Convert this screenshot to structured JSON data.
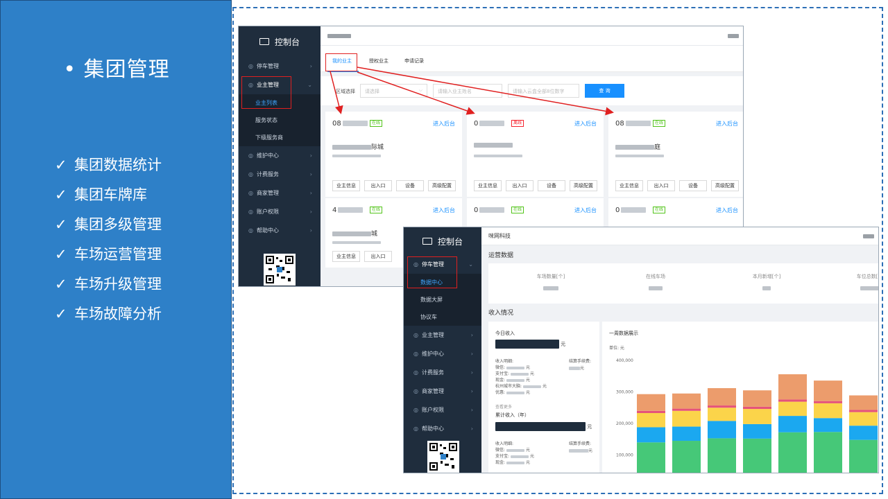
{
  "slide": {
    "title": "• 集团管理",
    "features": [
      "集团数据统计",
      "集团车牌库",
      "集团多级管理",
      "车场运营管理",
      "车场升级管理",
      "车场故障分析"
    ],
    "check_glyph": "✓"
  },
  "screen1": {
    "sidebar": {
      "brand": "控制台",
      "items": [
        {
          "icon": "circle-p-icon",
          "label": "停车管理"
        },
        {
          "icon": "building-icon",
          "label": "业主管理"
        },
        {
          "icon": "wrench-icon",
          "label": "维护中心"
        },
        {
          "icon": "billing-icon",
          "label": "计费服务"
        },
        {
          "icon": "shop-icon",
          "label": "商家管理"
        },
        {
          "icon": "account-icon",
          "label": "账户权限"
        },
        {
          "icon": "help-icon",
          "label": "帮助中心"
        }
      ],
      "subitems": [
        "业主列表",
        "服务状态",
        "下级服务商"
      ]
    },
    "tabs": [
      "我的业主",
      "授权业主",
      "申请记录"
    ],
    "filter": {
      "label": "区域选择",
      "select_placeholder": "请选择",
      "input1_placeholder": "请输入业主姓名",
      "input2_placeholder": "请输入云盒全部8位数字",
      "query": "查 询"
    },
    "cards": [
      {
        "num": "08",
        "badge": "在线",
        "status": "online",
        "enter": "进入后台",
        "name": "",
        "name_tail": "际城"
      },
      {
        "num": "0",
        "badge": "离线",
        "status": "offline",
        "enter": "进入后台",
        "name": "",
        "name_tail": ""
      },
      {
        "num": "08",
        "badge": "在线",
        "status": "online",
        "enter": "进入后台",
        "name": "",
        "name_tail": "庭"
      },
      {
        "num": "4",
        "badge": "在线",
        "status": "online",
        "enter": "进入后台",
        "name": "",
        "name_tail": "城"
      },
      {
        "num": "0",
        "badge": "在线",
        "status": "online",
        "enter": "进入后台",
        "name": "",
        "name_tail": ""
      },
      {
        "num": "0",
        "badge": "在线",
        "status": "online",
        "enter": "进入后台",
        "name": "",
        "name_tail": ""
      }
    ],
    "card_buttons": [
      "业主信息",
      "出入口",
      "设备",
      "高级配置"
    ]
  },
  "screen2": {
    "sidebar": {
      "brand": "控制台",
      "items": [
        {
          "icon": "circle-p-icon",
          "label": "停车管理"
        },
        {
          "icon": "building-icon",
          "label": "业主管理"
        },
        {
          "icon": "wrench-icon",
          "label": "维护中心"
        },
        {
          "icon": "billing-icon",
          "label": "计费服务"
        },
        {
          "icon": "shop-icon",
          "label": "商家管理"
        },
        {
          "icon": "account-icon",
          "label": "账户权限"
        },
        {
          "icon": "help-icon",
          "label": "帮助中心"
        }
      ],
      "subitems": [
        "数据中心",
        "数据大屏",
        "协议车"
      ]
    },
    "company": "咪网科技",
    "ops_title": "运营数据",
    "stats": [
      "车场数量[个]",
      "在线车场",
      "本月新增[个]",
      "车位总数[个]"
    ],
    "income_title": "收入情况",
    "today": {
      "title": "今日收入",
      "unit": "元",
      "breakdown_label": "收入明细:",
      "fee_label": "结算手续费:",
      "fee_unit": "元",
      "rows": [
        "微信:",
        "支付宝:",
        "现金:",
        "杭州城市大脑:",
        "优惠:"
      ],
      "row_units": [
        "元",
        "元",
        "元",
        "元",
        "元"
      ],
      "more": "查看更多"
    },
    "total": {
      "title": "累计收入（年）",
      "unit": "元",
      "breakdown_label": "收入明细:",
      "fee_label": "结算手续费:",
      "fee_unit": "元",
      "rows": [
        "微信:",
        "支付宝:",
        "现金:"
      ],
      "row_units": [
        "元",
        "元",
        "元"
      ]
    },
    "week_title": "一周数据展示",
    "unit_label": "单位: 元"
  },
  "chart_data": {
    "type": "bar",
    "stacked": true,
    "categories": [
      "",
      "",
      "",
      "",
      "",
      "",
      ""
    ],
    "series": [
      {
        "color": "#46c878",
        "values": [
          140000,
          145000,
          153000,
          152000,
          172000,
          173000,
          148000
        ]
      },
      {
        "color": "#1ba8f0",
        "values": [
          48000,
          45000,
          55000,
          46000,
          52000,
          44000,
          45000
        ]
      },
      {
        "color": "#fbd44a",
        "values": [
          45000,
          50000,
          42000,
          48000,
          45000,
          47000,
          43000
        ]
      },
      {
        "color": "#e5537a",
        "values": [
          7000,
          7000,
          7000,
          7000,
          7000,
          7000,
          7000
        ]
      },
      {
        "color": "#ec9c6c",
        "values": [
          53000,
          48000,
          55000,
          52000,
          80000,
          65000,
          46000
        ]
      }
    ],
    "yticks": [
      "400,000",
      "300,000",
      "200,000",
      "100,000"
    ],
    "ylim": [
      0,
      400000
    ],
    "grid": false
  }
}
